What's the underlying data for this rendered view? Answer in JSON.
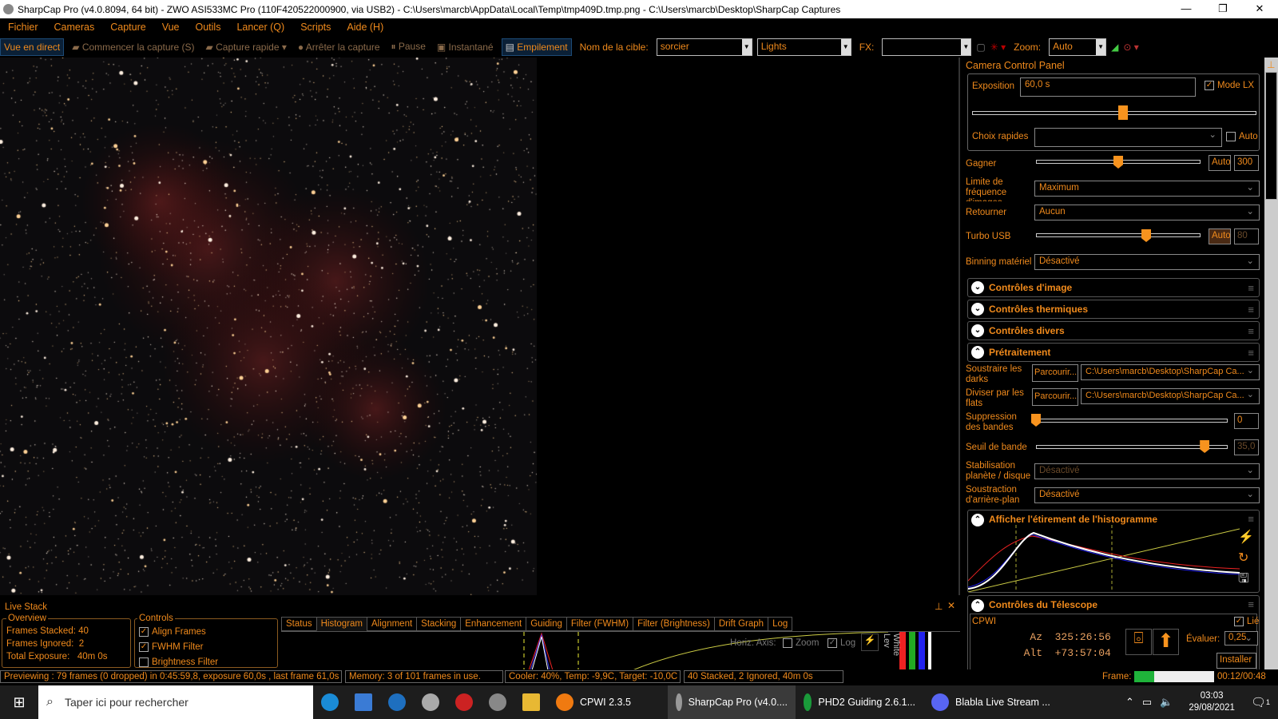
{
  "window": {
    "title": "SharpCap Pro (v4.0.8094, 64 bit) - ZWO ASI533MC Pro (110F420522000900, via USB2) - C:\\Users\\marcb\\AppData\\Local\\Temp\\tmp409D.tmp.png - C:\\Users\\marcb\\Desktop\\SharpCap Captures",
    "minimize": "—",
    "maximize": "❐",
    "close": "✕"
  },
  "menu": [
    "Fichier",
    "Cameras",
    "Capture",
    "Vue",
    "Outils",
    "Lancer (Q)",
    "Scripts",
    "Aide (H)"
  ],
  "toolbar": {
    "live": "Vue en direct",
    "start": "Commencer la capture (S)",
    "quick": "Capture rapide",
    "stop": "Arrêter la capture",
    "pause": "Pause",
    "snapshot": "Instantané",
    "stack": "Empilement",
    "target_label": "Nom de la cible:",
    "target": "sorcier",
    "frame_type": "Lights",
    "fx_label": "FX:",
    "fx": "",
    "zoom_label": "Zoom:",
    "zoom": "Auto"
  },
  "panel": {
    "title": "Camera Control Panel",
    "exposure_label": "Exposition",
    "exposure": "60,0 s",
    "lx_label": "Mode LX",
    "lx_checked": true,
    "exposure_slider": 0.53,
    "quick_label": "Choix rapides",
    "quick_value": "",
    "auto_label": "Auto",
    "gain_label": "Gagner",
    "gain_auto": "Auto",
    "gain": "300",
    "gain_slider": 0.5,
    "fps_label": "Limite de fréquence d'images",
    "fps": "Maximum",
    "flip_label": "Retourner",
    "flip": "Aucun",
    "turbo_label": "Turbo USB",
    "turbo_auto": "Auto",
    "turbo": "80",
    "turbo_slider": 0.67,
    "binning_label": "Binning matériel",
    "binning": "Désactivé",
    "sections": [
      "Contrôles d'image",
      "Contrôles thermiques",
      "Contrôles divers",
      "Prétraitement"
    ],
    "darks_label": "Soustraire les darks",
    "browse": "Parcourir...",
    "darks": "C:\\Users\\marcb\\Desktop\\SharpCap Ca...",
    "flats_label": "Diviser par les flats",
    "flats": "C:\\Users\\marcb\\Desktop\\SharpCap Ca...",
    "banding_label": "Suppression des bandes",
    "banding": "0",
    "banding_slider": 0,
    "band_thr_label": "Seuil de bande",
    "band_thr": "35,0",
    "band_thr_slider": 0.88,
    "stab_label": "Stabilisation planète / disque",
    "stab": "Désactivé",
    "bg_label": "Soustraction d'arrière-plan",
    "bg": "Désactivé",
    "histo_title": "Afficher l'étirement de l'histogramme",
    "tele_title": "Contrôles du Télescope",
    "tele_name": "CPWI",
    "linked": "Lié",
    "az_label": "Az",
    "az": "325:26:56",
    "alt_label": "Alt",
    "alt": "+73:57:04",
    "rate_label": "Évaluer:",
    "rate": "0,25",
    "install": "Installer"
  },
  "livestack": {
    "title": "Live Stack",
    "overview": "Overview",
    "stacked": "Frames Stacked: 40",
    "ignored": "Frames Ignored:  2",
    "total": "Total Exposure:   40m 0s",
    "controls": "Controls",
    "align": "Align Frames",
    "fwhm": "FWHM Filter",
    "bright": "Brightness Filter",
    "tabs": [
      "Status",
      "Histogram",
      "Alignment",
      "Stacking",
      "Enhancement",
      "Guiding",
      "Filter (FWHM)",
      "Filter (Brightness)",
      "Drift Graph",
      "Log"
    ],
    "active_tab": 1,
    "horiz": "Horiz. Axis:",
    "zoom": "Zoom",
    "log": "Log",
    "white": "White Lev"
  },
  "status": {
    "preview": "Previewing : 79 frames (0 dropped) in 0:45:59,8, exposure 60,0s , last frame 61,0s",
    "memory": "Memory: 3 of 101 frames in use.",
    "cooler": "Cooler: 40%, Temp: -9,9C, Target: -10,0C",
    "stack": "40 Stacked, 2 Ignored, 40m 0s",
    "frame_label": "Frame:",
    "frame_progress": 0.25,
    "time": "00:12/00:48"
  },
  "taskbar": {
    "search": "Taper ici pour rechercher",
    "apps": [
      "CPWI 2.3.5",
      "SharpCap Pro (v4.0....",
      "PHD2 Guiding 2.6.1...",
      "Blabla Live Stream ..."
    ],
    "time": "03:03",
    "date": "29/08/2021",
    "notif": "1"
  }
}
